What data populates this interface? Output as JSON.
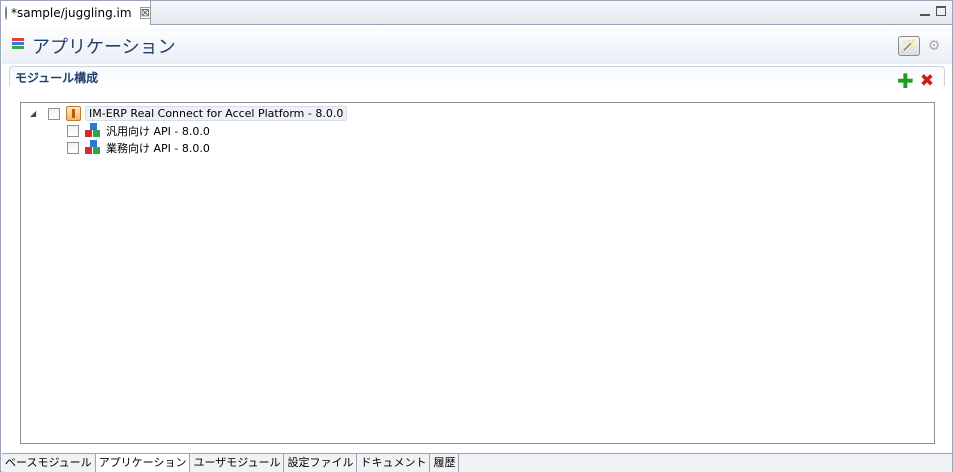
{
  "editor_tab": {
    "title": "*sample/juggling.im",
    "close_glyph": "⊠"
  },
  "header": {
    "title": "アプリケーション",
    "icon": "stacked-layers-icon",
    "icon_colors": [
      "#e04040",
      "#3a78d8",
      "#3aa84a"
    ],
    "wand_glyph": "🪄",
    "gear_glyph": "⚙"
  },
  "section": {
    "title": "モジュール構成",
    "add_glyph": "✚",
    "delete_glyph": "✖"
  },
  "tree": {
    "root": {
      "expander": "◢",
      "label": "IM-ERP Real Connect for Accel Platform - 8.0.0",
      "checked": false
    },
    "children": [
      {
        "label": "汎用向け API - 8.0.0",
        "checked": false
      },
      {
        "label": "業務向け API - 8.0.0",
        "checked": false
      }
    ]
  },
  "bottom_tabs": [
    {
      "label": "ベースモジュール",
      "active": false
    },
    {
      "label": "アプリケーション",
      "active": true
    },
    {
      "label": "ユーザモジュール",
      "active": false
    },
    {
      "label": "設定ファイル",
      "active": false
    },
    {
      "label": "ドキュメント",
      "active": false
    },
    {
      "label": "履歴",
      "active": false
    }
  ]
}
